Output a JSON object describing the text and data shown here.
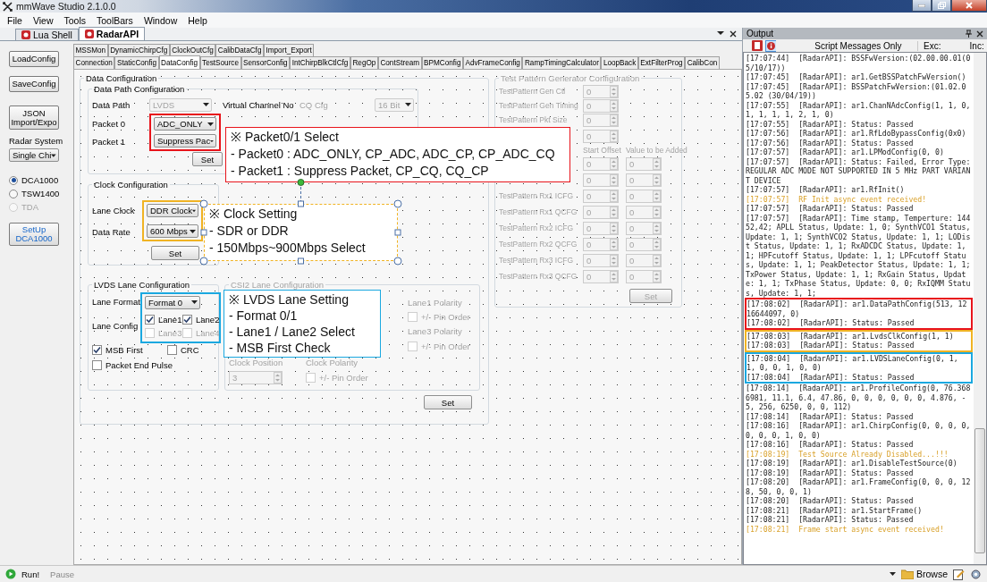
{
  "window": {
    "title": "mmWave Studio 2.1.0.0"
  },
  "menu": [
    "File",
    "View",
    "Tools",
    "ToolBars",
    "Window",
    "Help"
  ],
  "doc_tabs": [
    {
      "label": "Lua Shell",
      "selected": false
    },
    {
      "label": "RadarAPI",
      "selected": true
    }
  ],
  "sidebar": {
    "buttons": [
      "LoadConfig",
      "SaveConfig",
      "JSON Import/Expo"
    ],
    "radar_system_label": "Radar System",
    "radar_system_value": "Single Chi",
    "capture_devices": [
      {
        "label": "DCA1000",
        "selected": true,
        "disabled": false
      },
      {
        "label": "TSW1400",
        "selected": false,
        "disabled": false
      },
      {
        "label": "TDA",
        "selected": false,
        "disabled": true
      }
    ],
    "setup_button": "SetUp DCA1000"
  },
  "tabs": {
    "row1": [
      {
        "label": "MSSMon",
        "selected": false
      },
      {
        "label": "DynamicChirpCfg",
        "selected": false
      },
      {
        "label": "ClockOutCfg",
        "selected": false
      },
      {
        "label": "CalibDataCfg",
        "selected": false
      },
      {
        "label": "Import_Export",
        "selected": false
      }
    ],
    "row2": [
      {
        "label": "Connection",
        "selected": false
      },
      {
        "label": "StaticConfig",
        "selected": false
      },
      {
        "label": "DataConfig",
        "selected": true
      },
      {
        "label": "TestSource",
        "selected": false
      },
      {
        "label": "SensorConfig",
        "selected": false
      },
      {
        "label": "IntChirpBlkCtlCfg",
        "selected": false
      },
      {
        "label": "RegOp",
        "selected": false
      },
      {
        "label": "ContStream",
        "selected": false
      },
      {
        "label": "BPMConfig",
        "selected": false
      },
      {
        "label": "AdvFrameConfig",
        "selected": false
      },
      {
        "label": "RampTimingCalculator",
        "selected": false
      },
      {
        "label": "LoopBack",
        "selected": false
      },
      {
        "label": "ExtFilterProg",
        "selected": false
      },
      {
        "label": "CalibCon",
        "selected": false
      }
    ]
  },
  "data_config": {
    "title": "Data Configuration",
    "data_path": {
      "title": "Data Path Configuration",
      "data_path_label": "Data Path",
      "data_path_value": "LVDS",
      "data_path_disabled": true,
      "packet0_label": "Packet 0",
      "packet0_value": "ADC_ONLY",
      "packet1_label": "Packet 1",
      "packet1_value": "Suppress Pac",
      "virtual_channel_label": "Virtual Channel No",
      "cq_cfg_label": "CQ Cfg",
      "cq_cfg_value": "16 Bit",
      "cq_cfg_disabled": true,
      "set_button": "Set"
    },
    "clock": {
      "title": "Clock Configuration",
      "lane_clock_label": "Lane Clock",
      "lane_clock_value": "DDR Clock",
      "data_rate_label": "Data Rate",
      "data_rate_value": "600 Mbps",
      "set_button": "Set"
    },
    "lvds": {
      "title": "LVDS Lane Configuration",
      "lane_format_label": "Lane Format",
      "lane_format_value": "Format 0",
      "lane_config_label": "Lane Config",
      "lanes": [
        {
          "label": "Lane1",
          "checked": true,
          "disabled": false
        },
        {
          "label": "Lane2",
          "checked": true,
          "disabled": false
        },
        {
          "label": "Lane3",
          "checked": false,
          "disabled": true
        },
        {
          "label": "Lane4",
          "checked": false,
          "disabled": true
        }
      ],
      "options": [
        {
          "label": "MSB First",
          "checked": true
        },
        {
          "label": "CRC",
          "checked": false
        },
        {
          "label": "Packet End Pulse",
          "checked": false
        }
      ]
    },
    "csi2": {
      "title": "CSI2 Lane Configuration",
      "disabled": true,
      "lane1_polarity_label": "Lane1 Polarity",
      "lane1_polarity_option": "+/- Pin Order",
      "lane3_polarity_label": "Lane3 Polarity",
      "lane3_polarity_option": "+/- Pin Order",
      "clock_position_label": "Clock Position",
      "clock_position_value": "3",
      "clock_polarity_label": "Clock Polarity",
      "clock_polarity_option": "+/- Pin Order"
    },
    "set_button": "Set"
  },
  "test_pattern": {
    "title": "Test Pattern Generator Configuration",
    "disabled": true,
    "single_rows": [
      {
        "label": "TestPattern Gen Ctl",
        "value": "0"
      },
      {
        "label": "TestPattern Gen Timing",
        "value": "0"
      },
      {
        "label": "TestPattern Pkt Size",
        "value": "0"
      },
      {
        "value": "0"
      }
    ],
    "column_headers": [
      "Start Offset",
      "Value to be Added"
    ],
    "pair_rows": [
      {
        "values": [
          "0",
          "0"
        ]
      },
      {
        "values": [
          "0",
          "0"
        ]
      },
      {
        "label": "TestPattern Rx1 ICFG",
        "values": [
          "0",
          "0"
        ]
      },
      {
        "label": "TestPattern Rx1 QCFG",
        "values": [
          "0",
          "0"
        ]
      },
      {
        "label": "TestPattern Rx2 ICFG",
        "values": [
          "0",
          "0"
        ]
      },
      {
        "label": "TestPattern Rx2 QCFG",
        "values": [
          "0",
          "0"
        ]
      },
      {
        "label": "TestPattern Rx3 ICFG",
        "values": [
          "0",
          "0"
        ]
      },
      {
        "label": "TestPattern Rx3 QCFG",
        "values": [
          "0",
          "0"
        ]
      }
    ],
    "set_button": "Set"
  },
  "annotations": [
    {
      "color": "#e8141b",
      "selected": false,
      "lines": [
        "※ Packet0/1 Select",
        "- Packet0 : ADC_ONLY, CP_ADC, ADC_CP, CP_ADC_CQ",
        "- Packet1 : Suppress Packet, CP_CQ, CQ_CP"
      ]
    },
    {
      "color": "#f0b323",
      "selected": true,
      "lines": [
        "※ Clock Setting",
        "- SDR or DDR",
        "- 150Mbps~900Mbps Select"
      ]
    },
    {
      "color": "#1aa8e0",
      "selected": false,
      "lines": [
        "※ LVDS Lane Setting",
        "- Format 0/1",
        "- Lane1 / Lane2 Select",
        "- MSB First Check"
      ]
    }
  ],
  "output": {
    "title": "Output",
    "filter": "Script Messages Only",
    "exc_label": "Exc:",
    "inc_label": "Inc:",
    "log": [
      {
        "kind": "entry",
        "event": false,
        "message": "[17:07:44]  [RadarAPI]: BSSFwVersion:(02.00.00.01(05/10/17))"
      },
      {
        "kind": "entry",
        "event": false,
        "message": "[17:07:45]  [RadarAPI]: ar1.GetBSSPatchFwVersion()"
      },
      {
        "kind": "entry",
        "event": false,
        "message": "[17:07:45]  [RadarAPI]: BSSPatchFwVersion:(01.02.05.02 (30/04/19))"
      },
      {
        "kind": "entry",
        "event": false,
        "message": "[17:07:55]  [RadarAPI]: ar1.ChanNAdcConfig(1, 1, 0, 1, 1, 1, 1, 2, 1, 0)"
      },
      {
        "kind": "entry",
        "event": false,
        "message": "[17:07:55]  [RadarAPI]: Status: Passed"
      },
      {
        "kind": "entry",
        "event": false,
        "message": "[17:07:56]  [RadarAPI]: ar1.RfLdoBypassConfig(0x0)"
      },
      {
        "kind": "entry",
        "event": false,
        "message": "[17:07:56]  [RadarAPI]: Status: Passed"
      },
      {
        "kind": "entry",
        "event": false,
        "message": "[17:07:57]  [RadarAPI]: ar1.LPModConfig(0, 0)"
      },
      {
        "kind": "entry",
        "event": false,
        "message": "[17:07:57]  [RadarAPI]: Status: Failed, Error Type: REGULAR ADC MODE NOT SUPPORTED IN 5 MHz PART VARIANT DEVICE"
      },
      {
        "kind": "entry",
        "event": false,
        "message": "[17:07:57]  [RadarAPI]: ar1.RfInit()"
      },
      {
        "kind": "entry",
        "event": true,
        "message": "[17:07:57]  RF Init async event received!"
      },
      {
        "kind": "entry",
        "event": false,
        "message": "[17:07:57]  [RadarAPI]: Status: Passed"
      },
      {
        "kind": "entry",
        "event": false,
        "message": "[17:07:57]  [RadarAPI]: Time stamp, Temperture: 14452,42; APLL Status, Update: 1, 0; SynthVCO1 Status, Update: 1, 1; SynthVCO2 Status, Update: 1, 1; LODist Status, Update: 1, 1; RxADCDC Status, Update: 1, 1; HPFcutoff Status, Update: 1, 1; LPFcutoff Status, Update: 1, 1; PeakDetector Status, Update: 1, 1; TxPower Status, Update: 1, 1; RxGain Status, Update: 1, 1; TxPhase Status, Update: 0, 0; RxIQMM Status, Update: 1, 1;"
      },
      {
        "kind": "group",
        "color": "#e8141b",
        "entries": [
          {
            "event": false,
            "message": "[17:08:02]  [RadarAPI]: ar1.DataPathConfig(513, 1216644097, 0)"
          },
          {
            "event": false,
            "message": "[17:08:02]  [RadarAPI]: Status: Passed"
          }
        ]
      },
      {
        "kind": "group",
        "color": "#f0b323",
        "entries": [
          {
            "event": false,
            "message": "[17:08:03]  [RadarAPI]: ar1.LvdsClkConfig(1, 1)"
          },
          {
            "event": false,
            "message": "[17:08:03]  [RadarAPI]: Status: Passed"
          }
        ]
      },
      {
        "kind": "group",
        "color": "#1aa8e0",
        "entries": [
          {
            "event": false,
            "message": "[17:08:04]  [RadarAPI]: ar1.LVDSLaneConfig(0, 1, 1, 0, 0, 1, 0, 0)"
          },
          {
            "event": false,
            "message": "[17:08:04]  [RadarAPI]: Status: Passed"
          }
        ]
      },
      {
        "kind": "entry",
        "event": false,
        "message": "[17:08:14]  [RadarAPI]: ar1.ProfileConfig(0, 76.3686981, 11.1, 6.4, 47.86, 0, 0, 0, 0, 0, 0, 4.876, -5, 256, 6250, 0, 0, 112)"
      },
      {
        "kind": "entry",
        "event": false,
        "message": "[17:08:14]  [RadarAPI]: Status: Passed"
      },
      {
        "kind": "entry",
        "event": false,
        "message": "[17:08:16]  [RadarAPI]: ar1.ChirpConfig(0, 0, 0, 0, 0, 0, 0, 1, 0, 0)"
      },
      {
        "kind": "entry",
        "event": false,
        "message": "[17:08:16]  [RadarAPI]: Status: Passed"
      },
      {
        "kind": "entry",
        "event": true,
        "message": "[17:08:19]  Test Source Already Disabled...!!!"
      },
      {
        "kind": "entry",
        "event": false,
        "message": "[17:08:19]  [RadarAPI]: ar1.DisableTestSource(0)"
      },
      {
        "kind": "entry",
        "event": false,
        "message": "[17:08:19]  [RadarAPI]: Status: Passed"
      },
      {
        "kind": "entry",
        "event": false,
        "message": "[17:08:20]  [RadarAPI]: ar1.FrameConfig(0, 0, 0, 128, 50, 0, 0, 1)"
      },
      {
        "kind": "entry",
        "event": false,
        "message": "[17:08:20]  [RadarAPI]: Status: Passed"
      },
      {
        "kind": "entry",
        "event": false,
        "message": "[17:08:21]  [RadarAPI]: ar1.StartFrame()"
      },
      {
        "kind": "entry",
        "event": false,
        "message": "[17:08:21]  [RadarAPI]: Status: Passed"
      },
      {
        "kind": "entry",
        "event": true,
        "message": "[17:08:21]  Frame start async event received!"
      }
    ]
  },
  "status_bar": {
    "run": "Run!",
    "pause": "Pause",
    "pause_disabled": true,
    "browse": "Browse"
  }
}
